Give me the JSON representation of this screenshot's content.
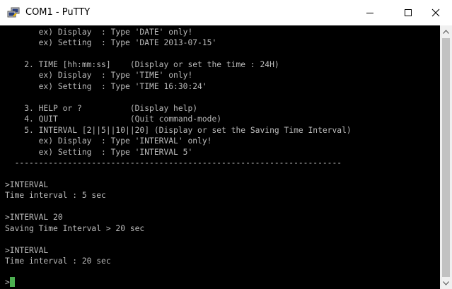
{
  "window": {
    "title": "COM1 - PuTTY",
    "app_icon": "putty-icon",
    "controls": [
      "minimize-icon",
      "maximize-icon",
      "close-icon"
    ]
  },
  "terminal": {
    "background": "#000000",
    "foreground": "#bbbbbb",
    "cursor_color": "#4caf50",
    "lines": [
      "       ex) Display  : Type 'DATE' only!",
      "       ex) Setting  : Type 'DATE 2013-07-15'",
      "",
      "    2. TIME [hh:mm:ss]    (Display or set the time : 24H)",
      "       ex) Display  : Type 'TIME' only!",
      "       ex) Setting  : Type 'TIME 16:30:24'",
      "",
      "    3. HELP or ?          (Display help)",
      "    4. QUIT               (Quit command-mode)",
      "    5. INTERVAL [2||5||10||20] (Display or set the Saving Time Interval)",
      "       ex) Display  : Type 'INTERVAL' only!",
      "       ex) Setting  : Type 'INTERVAL 5'",
      "  --------------------------------------------------------------------",
      "",
      ">INTERVAL",
      "Time interval : 5 sec",
      "",
      ">INTERVAL 20",
      "Saving Time Interval > 20 sec",
      "",
      ">INTERVAL",
      "Time interval : 20 sec",
      "",
      ">"
    ]
  }
}
